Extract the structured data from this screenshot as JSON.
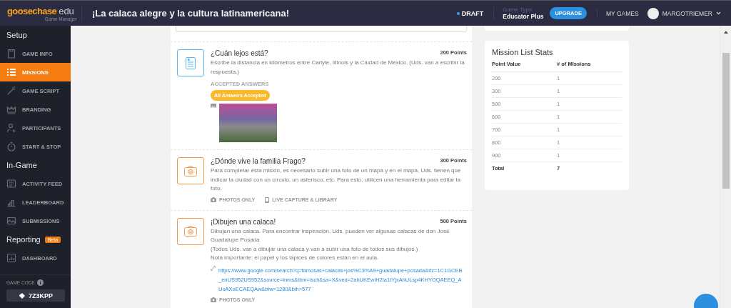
{
  "header": {
    "logo_main": "goosechase",
    "logo_edu": "edu",
    "logo_sub": "Game Manager",
    "title": "¡La calaca alegre y la cultura latinamericana!",
    "status": "DRAFT",
    "game_type_label": "Game Type",
    "game_type": "Educator Plus",
    "upgrade": "UPGRADE",
    "my_games": "MY GAMES",
    "user": "MARGOTRIEMER"
  },
  "sidebar": {
    "sections": [
      {
        "title": "Setup",
        "items": [
          {
            "label": "GAME INFO",
            "selected": false
          },
          {
            "label": "MISSIONS",
            "selected": true
          },
          {
            "label": "GAME SCRIPT",
            "selected": false
          },
          {
            "label": "BRANDING",
            "selected": false
          },
          {
            "label": "PARTICIPANTS",
            "selected": false
          },
          {
            "label": "START & STOP",
            "selected": false
          }
        ]
      },
      {
        "title": "In-Game",
        "items": [
          {
            "label": "ACTIVITY FEED",
            "selected": false
          },
          {
            "label": "LEADERBOARD",
            "selected": false
          },
          {
            "label": "SUBMISSIONS",
            "selected": false
          }
        ]
      },
      {
        "title": "Reporting",
        "badge": "Beta",
        "items": [
          {
            "label": "DASHBOARD",
            "selected": false
          }
        ]
      }
    ],
    "game_code_label": "GAME CODE",
    "game_code": "7Z3KPP"
  },
  "missions": [
    {
      "kind": "text",
      "title": "¿Cuán lejos está?",
      "points": "200 Points",
      "description": [
        "Escribe la distancia en kilómetros entre Carlyle, Illinois y la Ciudad de México. (Uds. van a escribir la respuesta.)"
      ],
      "accepted_label": "ACCEPTED ANSWERS",
      "accepted_badge": "All Answers Accepted",
      "attachments": [
        {
          "kind": "image"
        }
      ]
    },
    {
      "kind": "photo",
      "title": "¿Dónde vive la familia Frago?",
      "points": "300 Points",
      "description": [
        "Para completar esta misión, es necesario subir una foto de un mapa y en el mapa, Uds. tienen que indicar la ciudad con un círculo, un asterisco, etc. Para esto, utilicen una herramienta para editar la foto."
      ],
      "tags": [
        {
          "kind": "camera",
          "label": "PHOTOS ONLY"
        },
        {
          "kind": "phone",
          "label": "LIVE CAPTURE & LIBRARY"
        }
      ]
    },
    {
      "kind": "photo",
      "title": "¡Dibujen una calaca!",
      "points": "500 Points",
      "description": [
        "Dibujen una calaca. Para encontrar inspiración, Uds. pueden ver algunas calacas de don José Guadalupe Posada",
        "(Todos Uds. van a dibujar una calaca y van a subir una foto de todos sus dibujos.)",
        "Nota importante: el papel y los lápices de colores están en el aula."
      ],
      "link": "https://www.google.com/search?q=famosas+calacas+jos%C3%A9+guadalupe+posada&rlz=1C1GCEB_enUS952US952&source=lnms&tbm=isch&sa=X&ved=2ahUKEwiH2Ia1tYjxAhULsp4KHYOQAEEQ_AUoAXoECAEQAw&biw=1280&bih=577",
      "tags": [
        {
          "kind": "camera",
          "label": "PHOTOS ONLY"
        }
      ]
    }
  ],
  "stats": {
    "title": "Mission List Stats",
    "columns": [
      "Point Value",
      "# of Missions"
    ],
    "rows": [
      [
        "200",
        "1"
      ],
      [
        "300",
        "1"
      ],
      [
        "500",
        "1"
      ],
      [
        "600",
        "1"
      ],
      [
        "700",
        "1"
      ],
      [
        "800",
        "1"
      ],
      [
        "900",
        "1"
      ]
    ],
    "total": [
      "Total",
      "7"
    ]
  }
}
